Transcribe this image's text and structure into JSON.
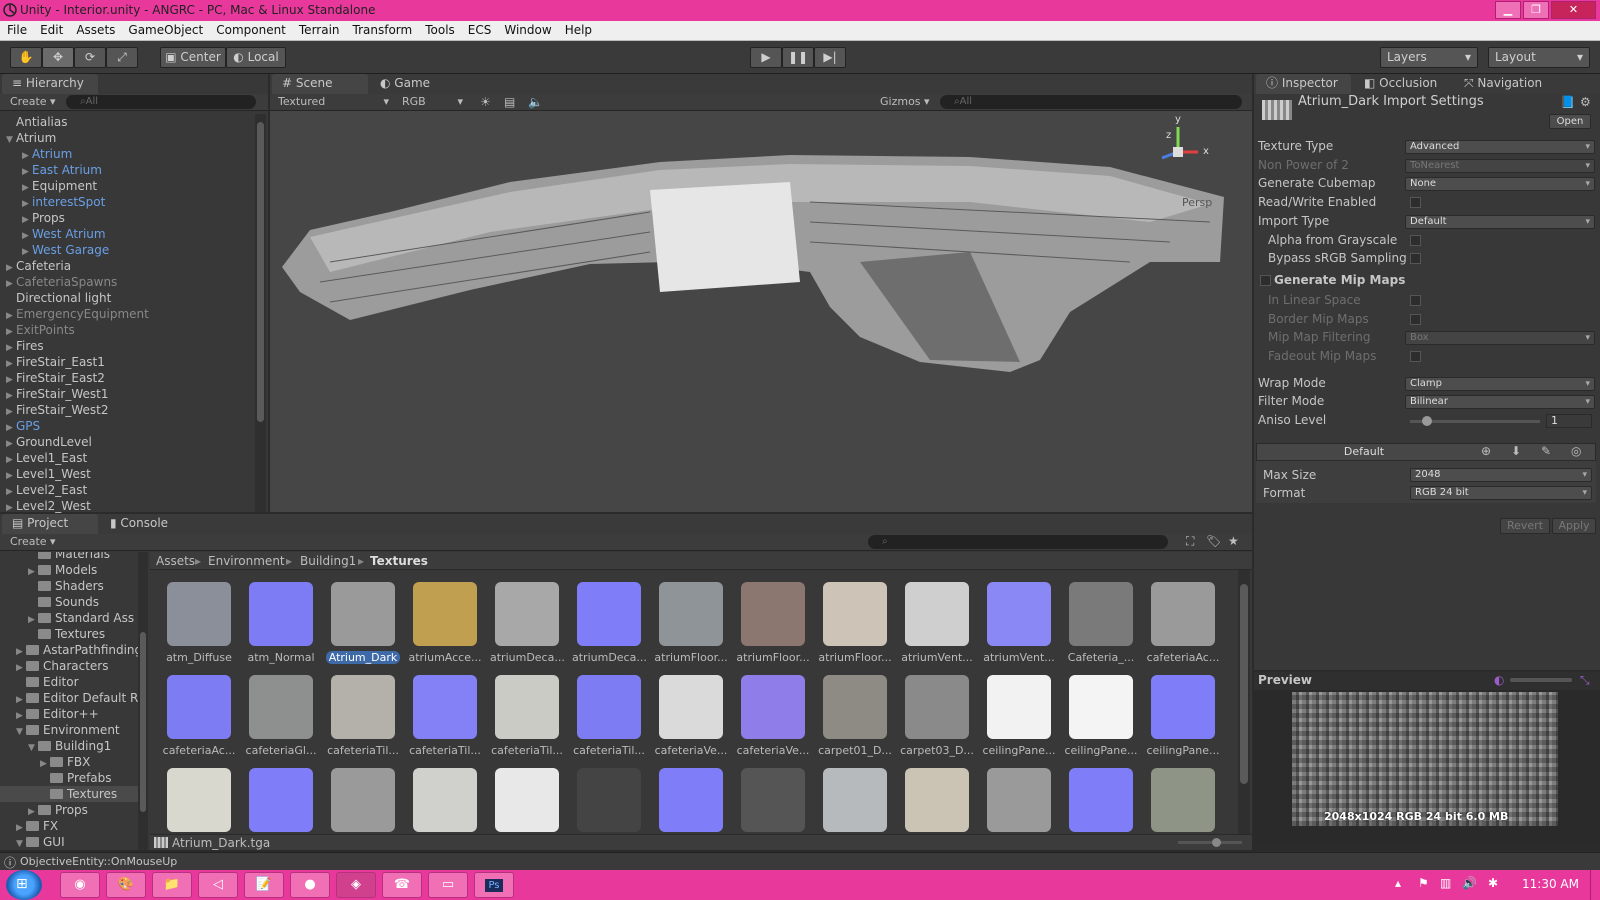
{
  "window": {
    "title": "Unity - Interior.unity - ANGRC - PC, Mac & Linux Standalone"
  },
  "menu": [
    "File",
    "Edit",
    "Assets",
    "GameObject",
    "Component",
    "Terrain",
    "Transform",
    "Tools",
    "ECS",
    "Window",
    "Help"
  ],
  "toolbar": {
    "pivot": "Center",
    "space": "Local",
    "layers": "Layers",
    "layout": "Layout"
  },
  "hierarchy": {
    "tab": "Hierarchy",
    "create": "Create",
    "search_placeholder": "All",
    "items": [
      {
        "label": "Antialias",
        "indent": 0,
        "arrow": ""
      },
      {
        "label": "Atrium",
        "indent": 0,
        "arrow": "▼"
      },
      {
        "label": "Atrium",
        "indent": 1,
        "arrow": "▶",
        "color": "blue"
      },
      {
        "label": "East Atrium",
        "indent": 1,
        "arrow": "▶",
        "color": "blue"
      },
      {
        "label": "Equipment",
        "indent": 1,
        "arrow": "▶"
      },
      {
        "label": "interestSpot",
        "indent": 1,
        "arrow": "▶",
        "color": "blue"
      },
      {
        "label": "Props",
        "indent": 1,
        "arrow": "▶"
      },
      {
        "label": "West Atrium",
        "indent": 1,
        "arrow": "▶",
        "color": "blue"
      },
      {
        "label": "West Garage",
        "indent": 1,
        "arrow": "▶",
        "color": "blue"
      },
      {
        "label": "Cafeteria",
        "indent": 0,
        "arrow": "▶"
      },
      {
        "label": "CafeteriaSpawns",
        "indent": 0,
        "arrow": "▶",
        "color": "dim"
      },
      {
        "label": "Directional light",
        "indent": 0,
        "arrow": ""
      },
      {
        "label": "EmergencyEquipment",
        "indent": 0,
        "arrow": "▶",
        "color": "dim"
      },
      {
        "label": "ExitPoints",
        "indent": 0,
        "arrow": "▶",
        "color": "dim"
      },
      {
        "label": "Fires",
        "indent": 0,
        "arrow": "▶"
      },
      {
        "label": "FireStair_East1",
        "indent": 0,
        "arrow": "▶"
      },
      {
        "label": "FireStair_East2",
        "indent": 0,
        "arrow": "▶"
      },
      {
        "label": "FireStair_West1",
        "indent": 0,
        "arrow": "▶"
      },
      {
        "label": "FireStair_West2",
        "indent": 0,
        "arrow": "▶"
      },
      {
        "label": "GPS",
        "indent": 0,
        "arrow": "▶",
        "color": "blue"
      },
      {
        "label": "GroundLevel",
        "indent": 0,
        "arrow": "▶"
      },
      {
        "label": "Level1_East",
        "indent": 0,
        "arrow": "▶"
      },
      {
        "label": "Level1_West",
        "indent": 0,
        "arrow": "▶"
      },
      {
        "label": "Level2_East",
        "indent": 0,
        "arrow": "▶"
      },
      {
        "label": "Level2_West",
        "indent": 0,
        "arrow": "▶"
      }
    ]
  },
  "scene": {
    "tab_scene": "Scene",
    "tab_game": "Game",
    "render_mode": "Textured",
    "color_mode": "RGB",
    "gizmos": "Gizmos",
    "search_placeholder": "All",
    "axis_x": "x",
    "axis_y": "y",
    "axis_z": "z",
    "view_label": "Persp"
  },
  "inspector": {
    "tabs": [
      "Inspector",
      "Occlusion",
      "Navigation"
    ],
    "title": "Atrium_Dark Import Settings",
    "open": "Open",
    "props": [
      {
        "label": "Texture Type",
        "value": "Advanced",
        "kind": "drop"
      },
      {
        "label": "Non Power of 2",
        "value": "ToNearest",
        "kind": "drop",
        "dim": true
      },
      {
        "label": "Generate Cubemap",
        "value": "None",
        "kind": "drop"
      },
      {
        "label": "Read/Write Enabled",
        "kind": "chk"
      },
      {
        "label": "Import Type",
        "value": "Default",
        "kind": "drop"
      },
      {
        "label": "Alpha from Grayscale",
        "kind": "chk",
        "indent": true
      },
      {
        "label": "Bypass sRGB Sampling",
        "kind": "chk",
        "indent": true
      },
      {
        "label": "Generate Mip Maps",
        "kind": "head"
      },
      {
        "label": "In Linear Space",
        "kind": "chk",
        "indent": true,
        "dim": true
      },
      {
        "label": "Border Mip Maps",
        "kind": "chk",
        "indent": true,
        "dim": true
      },
      {
        "label": "Mip Map Filtering",
        "value": "Box",
        "kind": "drop",
        "indent": true,
        "dim": true
      },
      {
        "label": "Fadeout Mip Maps",
        "kind": "chk",
        "indent": true,
        "dim": true
      },
      {
        "label": "Wrap Mode",
        "value": "Clamp",
        "kind": "drop"
      },
      {
        "label": "Filter Mode",
        "value": "Bilinear",
        "kind": "drop"
      },
      {
        "label": "Aniso Level",
        "value": "1",
        "kind": "slider"
      }
    ],
    "platform_default": "Default",
    "max_size_label": "Max Size",
    "max_size": "2048",
    "format_label": "Format",
    "format": "RGB 24 bit",
    "revert": "Revert",
    "apply": "Apply",
    "preview_label": "Preview",
    "preview_caption": "2048x1024  RGB 24 bit  6.0 MB"
  },
  "project": {
    "tab_project": "Project",
    "tab_console": "Console",
    "create": "Create",
    "tree": [
      {
        "label": "Materials",
        "indent": 2,
        "arrow": ""
      },
      {
        "label": "Models",
        "indent": 2,
        "arrow": "▶"
      },
      {
        "label": "Shaders",
        "indent": 2,
        "arrow": ""
      },
      {
        "label": "Sounds",
        "indent": 2,
        "arrow": ""
      },
      {
        "label": "Standard Ass",
        "indent": 2,
        "arrow": "▶"
      },
      {
        "label": "Textures",
        "indent": 2,
        "arrow": ""
      },
      {
        "label": "AstarPathfinding",
        "indent": 1,
        "arrow": "▶"
      },
      {
        "label": "Characters",
        "indent": 1,
        "arrow": "▶"
      },
      {
        "label": "Editor",
        "indent": 1,
        "arrow": ""
      },
      {
        "label": "Editor Default R",
        "indent": 1,
        "arrow": "▶"
      },
      {
        "label": "Editor++",
        "indent": 1,
        "arrow": "▶"
      },
      {
        "label": "Environment",
        "indent": 1,
        "arrow": "▼"
      },
      {
        "label": "Building1",
        "indent": 2,
        "arrow": "▼"
      },
      {
        "label": "FBX",
        "indent": 3,
        "arrow": "▶"
      },
      {
        "label": "Prefabs",
        "indent": 3,
        "arrow": ""
      },
      {
        "label": "Textures",
        "indent": 3,
        "arrow": "",
        "selected": true
      },
      {
        "label": "Props",
        "indent": 2,
        "arrow": "▶"
      },
      {
        "label": "FX",
        "indent": 1,
        "arrow": "▶"
      },
      {
        "label": "GUI",
        "indent": 1,
        "arrow": "▼"
      }
    ],
    "breadcrumb": [
      "Assets",
      "Environment",
      "Building1",
      "Textures"
    ],
    "assets": [
      {
        "label": "atm_Diffuse",
        "color": "#8a8f9a"
      },
      {
        "label": "atm_Normal",
        "color": "#7d7cf5"
      },
      {
        "label": "Atrium_Dark",
        "color": "#9a9a9a",
        "selected": true
      },
      {
        "label": "atriumAcce...",
        "color": "#c0a050"
      },
      {
        "label": "atriumDeca...",
        "color": "#a8a8a8"
      },
      {
        "label": "atriumDeca...",
        "color": "#7f7ef8"
      },
      {
        "label": "atriumFloor...",
        "color": "#8e9498"
      },
      {
        "label": "atriumFloor...",
        "color": "#8c7670"
      },
      {
        "label": "atriumFloor...",
        "color": "#cdc3b6"
      },
      {
        "label": "atriumVent...",
        "color": "#cfcfcf"
      },
      {
        "label": "atriumVent...",
        "color": "#8a88f4"
      },
      {
        "label": "Cafeteria_...",
        "color": "#7a7a7a"
      },
      {
        "label": "cafeteriaAc...",
        "color": "#9a9a9a"
      },
      {
        "label": "cafeteriaAc...",
        "color": "#7e7cf2"
      },
      {
        "label": "cafeteriaGl...",
        "color": "#8e9090"
      },
      {
        "label": "cafeteriaTil...",
        "color": "#b4b1aa"
      },
      {
        "label": "cafeteriaTil...",
        "color": "#8381f5"
      },
      {
        "label": "cafeteriaTil...",
        "color": "#c9cbc4"
      },
      {
        "label": "cafeteriaTil...",
        "color": "#7e7cf2"
      },
      {
        "label": "cafeteriaVe...",
        "color": "#dadada"
      },
      {
        "label": "cafeteriaVe...",
        "color": "#8f7de9"
      },
      {
        "label": "carpet01_D...",
        "color": "#8e8a84"
      },
      {
        "label": "carpet03_D...",
        "color": "#8a8a8a"
      },
      {
        "label": "ceilingPane...",
        "color": "#f2f2f2"
      },
      {
        "label": "ceilingPane...",
        "color": "#f4f4f4"
      },
      {
        "label": "ceilingPane...",
        "color": "#7f7ef8"
      },
      {
        "label": "",
        "color": "#d8d8cf"
      },
      {
        "label": "",
        "color": "#7f7ef8"
      },
      {
        "label": "",
        "color": "#9a9a9a"
      },
      {
        "label": "",
        "color": "#d0d0cc"
      },
      {
        "label": "",
        "color": "#e8e8e8"
      },
      {
        "label": "",
        "color": "#444444"
      },
      {
        "label": "",
        "color": "#7f7ef8"
      },
      {
        "label": "",
        "color": "#555555"
      },
      {
        "label": "",
        "color": "#b6babd"
      },
      {
        "label": "",
        "color": "#cbc3b4"
      },
      {
        "label": "",
        "color": "#9a9a9a"
      },
      {
        "label": "",
        "color": "#7f7ef8"
      },
      {
        "label": "",
        "color": "#8e9486"
      }
    ],
    "selected_file": "Atrium_Dark.tga"
  },
  "status": {
    "message": "ObjectiveEntity::OnMouseUp"
  },
  "taskbar": {
    "time": "11:30 AM"
  }
}
